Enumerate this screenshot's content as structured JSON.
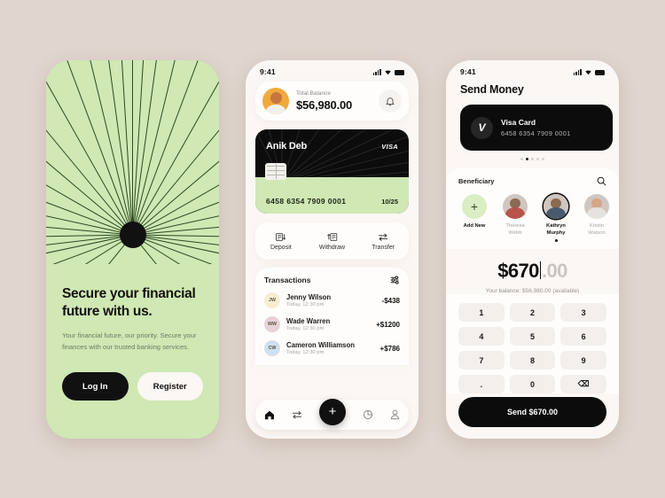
{
  "theme": {
    "background": "#e1d6cf",
    "green": "#cfe8b4",
    "dark": "#0c0c0c",
    "surface": "#fbf7f4"
  },
  "onboarding": {
    "title": "Secure your financial future with us.",
    "subtitle": "Your financial future, our priority. Secure your finances with our trusted banking services.",
    "login_label": "Log In",
    "register_label": "Register"
  },
  "home": {
    "status": {
      "time": "9:41"
    },
    "balance": {
      "label": "Total Balance",
      "amount": "$56,980.00"
    },
    "card": {
      "holder": "Anik Deb",
      "brand": "VISA",
      "number": "6458 6354 7909 0001",
      "expiry": "10/25"
    },
    "actions": [
      {
        "label": "Deposit",
        "icon": "deposit-icon"
      },
      {
        "label": "Withdraw",
        "icon": "withdraw-icon"
      },
      {
        "label": "Transfer",
        "icon": "transfer-icon"
      }
    ],
    "transactions_title": "Transactions",
    "transactions": [
      {
        "initials": "JW",
        "name": "Jenny Wilson",
        "time": "Today, 12:30 pm",
        "amount": "-$438",
        "color": "#f6edd2"
      },
      {
        "initials": "WW",
        "name": "Wade Warren",
        "time": "Today, 12:30 pm",
        "amount": "+$1200",
        "color": "#e8d2da"
      },
      {
        "initials": "CW",
        "name": "Cameron Williamson",
        "time": "Today, 12:30 pm",
        "amount": "+$786",
        "color": "#cfe0ef"
      }
    ],
    "nav": [
      {
        "name": "home-icon"
      },
      {
        "name": "transfer-icon"
      },
      {
        "name": "add-icon",
        "label": "+"
      },
      {
        "name": "analytics-icon"
      },
      {
        "name": "profile-icon"
      }
    ]
  },
  "send": {
    "status": {
      "time": "9:41"
    },
    "title": "Send Money",
    "card": {
      "brand_letter": "V",
      "name": "Visa Card",
      "number": "6458 6354 7909 0001"
    },
    "carousel_dots": 5,
    "carousel_active": 1,
    "beneficiary_title": "Beneficiary",
    "beneficiaries": [
      {
        "label": "Add New",
        "type": "add"
      },
      {
        "label": "Theresa Webb",
        "type": "person"
      },
      {
        "label": "Kathryn Murphy",
        "type": "person",
        "selected": true
      },
      {
        "label": "Kristin Watson",
        "type": "person"
      }
    ],
    "amount": {
      "entered": "$670",
      "fraction": ".00"
    },
    "balance_note": "Your balance: $56,980.00 (available)",
    "keypad": [
      "1",
      "2",
      "3",
      "4",
      "5",
      "6",
      "7",
      "8",
      "9",
      ".",
      "0",
      "⌫"
    ],
    "send_label": "Send $670.00"
  }
}
